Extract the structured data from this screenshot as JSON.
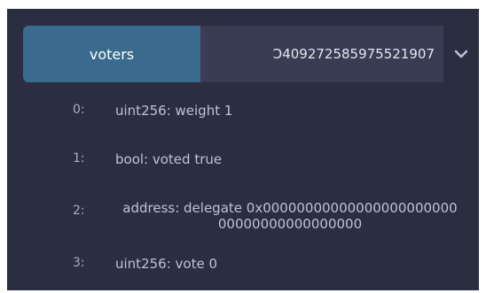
{
  "function_call": {
    "button_label": "voters",
    "input_value": "Ɔ409272585975521907",
    "toggle_icon": "chevron-down-icon"
  },
  "results": [
    {
      "index": "0:",
      "text": "uint256: weight 1"
    },
    {
      "index": "1:",
      "text": "bool: voted true"
    },
    {
      "index": "2:",
      "text": "address: delegate 0x0000000000000000000000000000000000000000"
    },
    {
      "index": "3:",
      "text": "uint256: vote 0"
    }
  ],
  "colors": {
    "panel_bg": "#2b2d41",
    "button_bg": "#3a6a8d",
    "input_bg": "#3a3c53",
    "text": "#bfc2d8"
  }
}
